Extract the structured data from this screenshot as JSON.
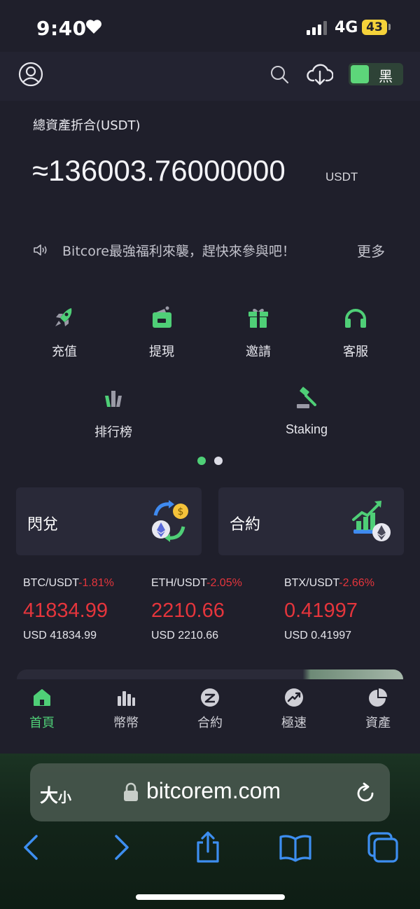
{
  "status": {
    "time": "9:40",
    "network": "4G",
    "battery": "43"
  },
  "header": {
    "theme_label": "黑"
  },
  "assets": {
    "label": "總資產折合(USDT)",
    "value": "≈136003.76000000",
    "unit": "USDT"
  },
  "notice": {
    "text": "Bitcore最強福利來襲，趕快來參與吧！",
    "more": "更多"
  },
  "menu": {
    "items": [
      {
        "label": "充值",
        "icon": "rocket-icon"
      },
      {
        "label": "提現",
        "icon": "wallet-icon"
      },
      {
        "label": "邀請",
        "icon": "gift-icon"
      },
      {
        "label": "客服",
        "icon": "headset-icon"
      },
      {
        "label": "排行榜",
        "icon": "ranking-icon"
      },
      {
        "label": "Staking",
        "icon": "gavel-icon"
      }
    ]
  },
  "cards": [
    {
      "label": "閃兌",
      "icon": "exchange-icon"
    },
    {
      "label": "合約",
      "icon": "contract-chart-icon"
    }
  ],
  "tickers": [
    {
      "pair": "BTC/USDT",
      "change": "-1.81%",
      "price": "41834.99",
      "usd": "USD 41834.99"
    },
    {
      "pair": "ETH/USDT",
      "change": "-2.05%",
      "price": "2210.66",
      "usd": "USD 2210.66"
    },
    {
      "pair": "BTX/USDT",
      "change": "-2.66%",
      "price": "0.41997",
      "usd": "USD 0.41997"
    }
  ],
  "tabs": [
    {
      "label": "首頁",
      "icon": "home-icon",
      "active": true
    },
    {
      "label": "幣幣",
      "icon": "bars-icon"
    },
    {
      "label": "合約",
      "icon": "contract-icon"
    },
    {
      "label": "極速",
      "icon": "trend-icon"
    },
    {
      "label": "資產",
      "icon": "pie-icon"
    }
  ],
  "browser": {
    "text_size_big": "大",
    "text_size_small": "小",
    "url": "bitcorem.com"
  },
  "colors": {
    "accent_green": "#4fcf77",
    "down_red": "#e5353c",
    "background": "#1f1f2b"
  }
}
